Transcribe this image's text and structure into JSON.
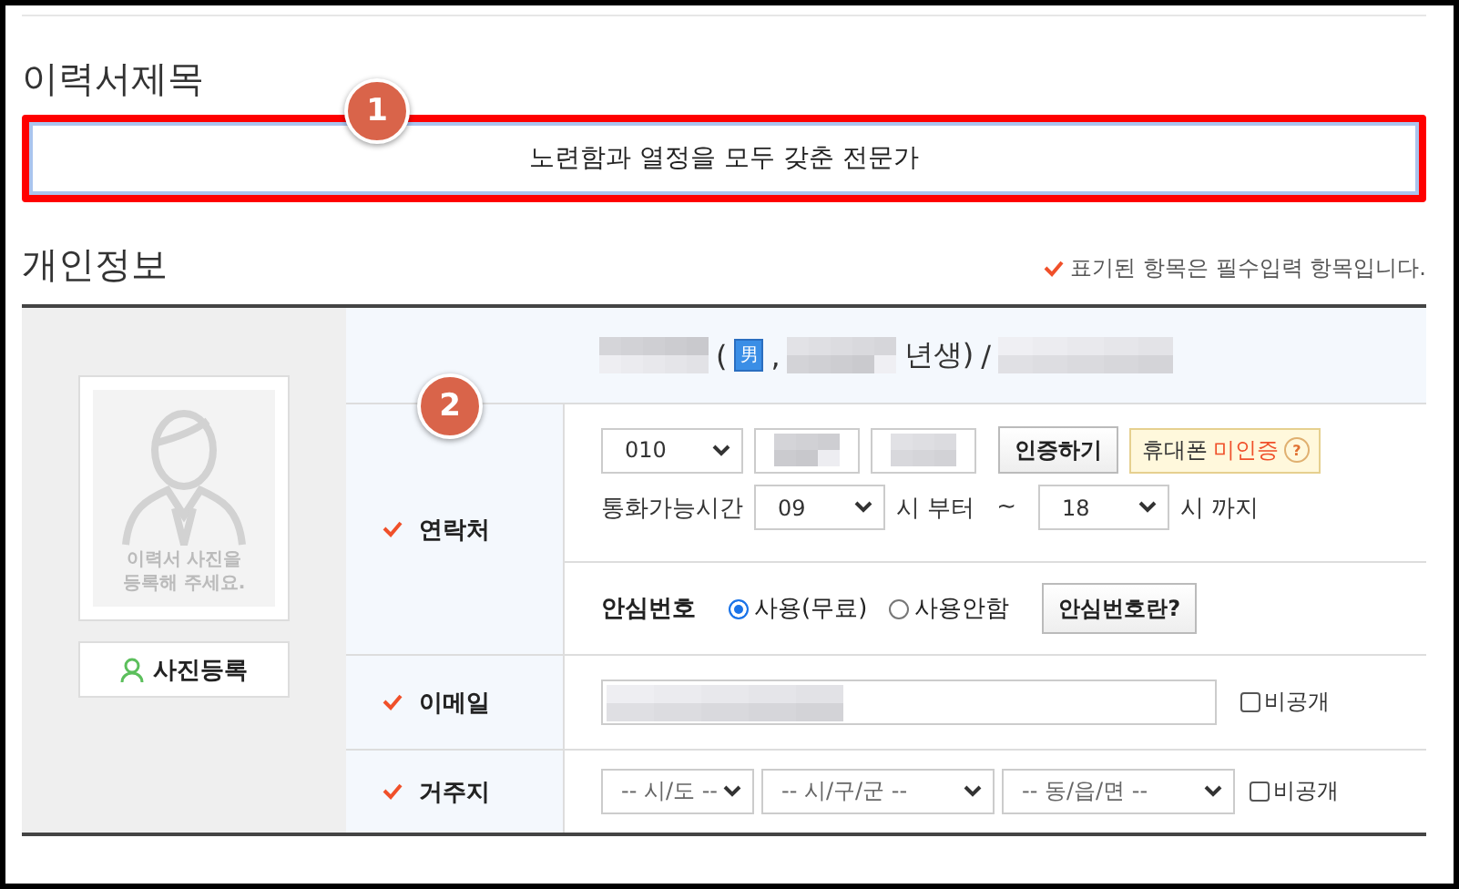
{
  "resume_title": {
    "heading": "이력서제목",
    "badge": "1",
    "value": "노련함과 열정을 모두 갖춘 전문가"
  },
  "personal_info": {
    "heading": "개인정보",
    "required_note": "표기된 항목은 필수입력 항목입니다.",
    "photo": {
      "placeholder": "이력서 사진을 등록해 주세요.",
      "button": "사진등록"
    },
    "summary": {
      "open": "(",
      "gender": "男",
      "comma": ",",
      "birth_suffix": "년생)",
      "slash": "/"
    },
    "badge": "2",
    "contact": {
      "label": "연락처",
      "required": true,
      "prefix": "010",
      "verify_button": "인증하기",
      "status_label": "휴대폰",
      "status": "미인증",
      "help": "?",
      "call_time_label": "통화가능시간",
      "from": "09",
      "from_suffix": "시 부터",
      "tilde": "~",
      "to": "18",
      "to_suffix": "시 까지"
    },
    "safe_number": {
      "label": "안심번호",
      "options": [
        {
          "label": "사용(무료)",
          "selected": true
        },
        {
          "label": "사용안함",
          "selected": false
        }
      ],
      "info_button": "안심번호란?"
    },
    "email": {
      "label": "이메일",
      "required": true,
      "private": {
        "label": "비공개",
        "checked": false
      }
    },
    "address": {
      "label": "거주지",
      "required": true,
      "selects": [
        "-- 시/도 --",
        "-- 시/구/군 --",
        "-- 동/읍/면 --"
      ],
      "private": {
        "label": "비공개",
        "checked": false
      }
    }
  }
}
